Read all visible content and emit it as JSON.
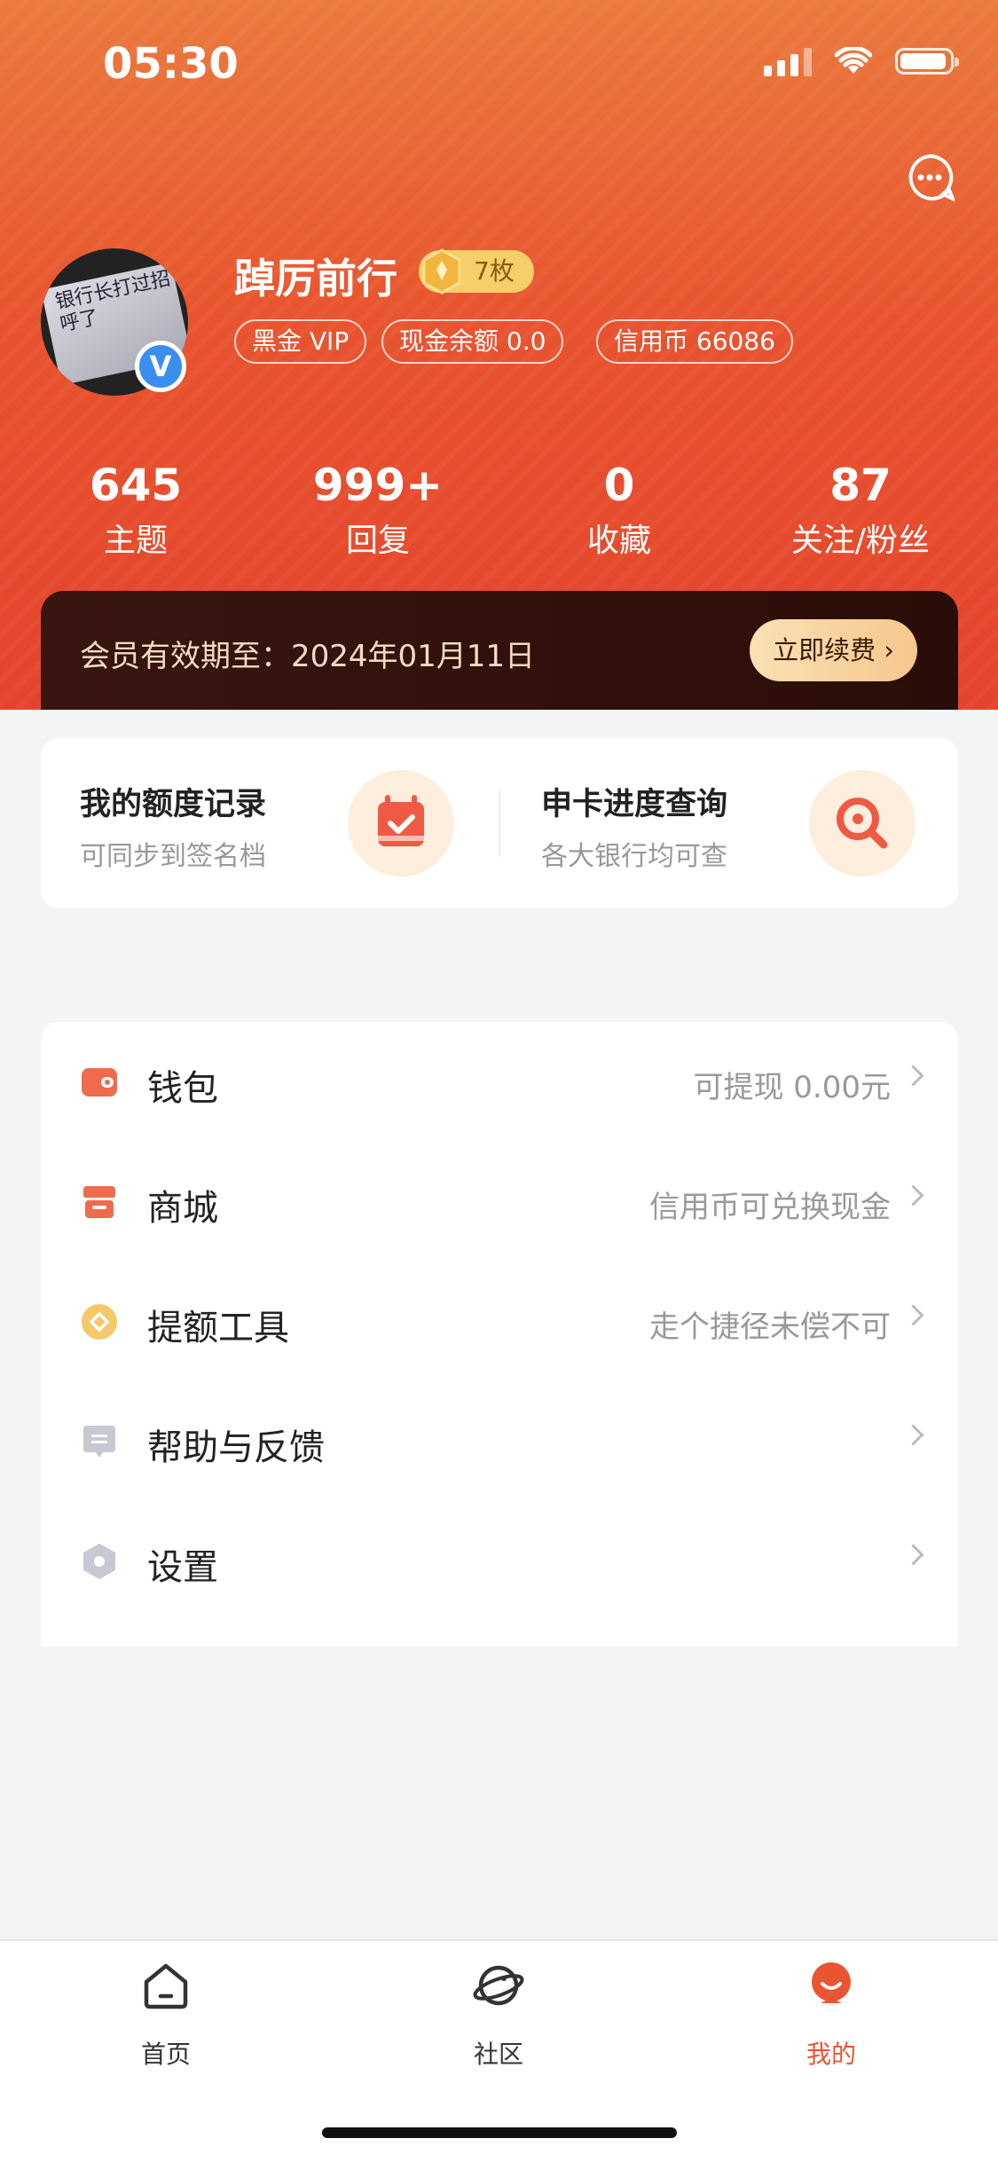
{
  "status_bar": {
    "time": "05:30"
  },
  "profile": {
    "username": "踔厉前行",
    "coin_badge": "7枚",
    "avatar_text": "银行长打过招呼了",
    "avatar_badge": "V",
    "tags": [
      "黑金 VIP",
      "现金余额 0.0",
      "信用币 66086"
    ]
  },
  "stats": [
    {
      "value": "645",
      "label": "主题"
    },
    {
      "value": "999+",
      "label": "回复"
    },
    {
      "value": "0",
      "label": "收藏"
    },
    {
      "value": "87",
      "label": "关注/粉丝"
    }
  ],
  "vip": {
    "text": "会员有效期至：2024年01月11日",
    "button": "立即续费 ›"
  },
  "quick_actions": [
    {
      "title": "我的额度记录",
      "subtitle": "可同步到签名档",
      "icon": "calendar-check-icon"
    },
    {
      "title": "申卡进度查询",
      "subtitle": "各大银行均可查",
      "icon": "search-magnifier-icon"
    }
  ],
  "menu": [
    {
      "label": "钱包",
      "right": "可提现 0.00元",
      "icon": "wallet-icon",
      "color": "#ee6b4d"
    },
    {
      "label": "商城",
      "right": "信用币可兑换现金",
      "icon": "store-icon",
      "color": "#ee6b4d"
    },
    {
      "label": "提额工具",
      "right": "走个捷径未偿不可",
      "icon": "coin-tool-icon",
      "color": "#f6c86a"
    },
    {
      "label": "帮助与反馈",
      "right": "",
      "icon": "chat-help-icon",
      "color": "#b9bcc8"
    },
    {
      "label": "设置",
      "right": "",
      "icon": "settings-hexagon-icon",
      "color": "#b9bcc8"
    }
  ],
  "tabbar": [
    {
      "label": "首页",
      "icon": "home-icon",
      "active": false
    },
    {
      "label": "社区",
      "icon": "planet-icon",
      "active": false
    },
    {
      "label": "我的",
      "icon": "profile-face-icon",
      "active": true
    }
  ],
  "colors": {
    "accent": "#ea5531",
    "vip_bar": "#2a0d08",
    "vip_button": "#f5c78c"
  }
}
